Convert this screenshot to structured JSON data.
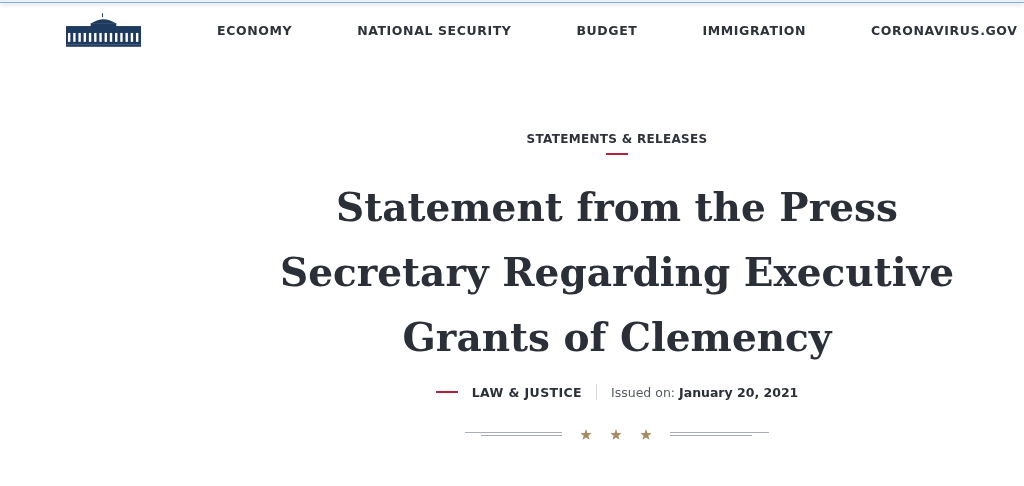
{
  "nav": {
    "items": [
      {
        "label": "ECONOMY"
      },
      {
        "label": "NATIONAL SECURITY"
      },
      {
        "label": "BUDGET"
      },
      {
        "label": "IMMIGRATION"
      },
      {
        "label": "CORONAVIRUS.GOV"
      }
    ]
  },
  "article": {
    "category": "STATEMENTS & RELEASES",
    "title": "Statement from the Press Secretary Regarding Executive Grants of Clemency",
    "topic": "LAW & JUSTICE",
    "issued_label": "Issued on:",
    "issued_date": "January 20, 2021"
  }
}
